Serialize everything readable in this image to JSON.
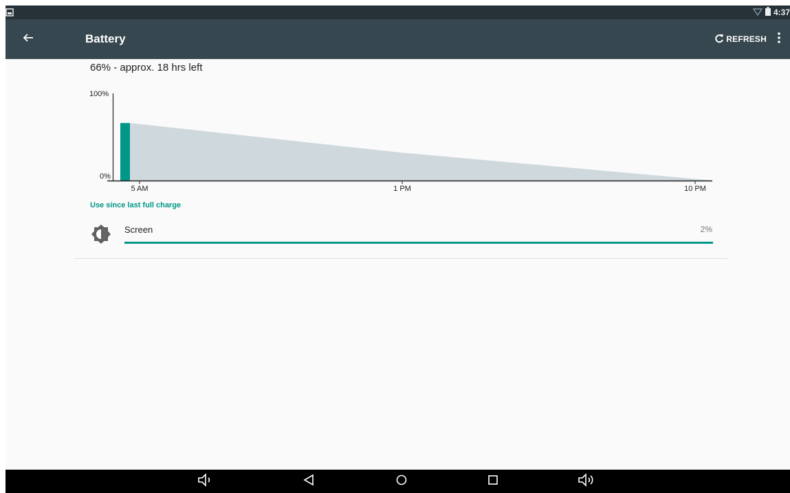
{
  "status_bar": {
    "time": "4:37"
  },
  "app_bar": {
    "title": "Battery",
    "refresh_label": "REFRESH"
  },
  "summary": {
    "text": "66% - approx. 18 hrs left"
  },
  "chart_data": {
    "type": "area",
    "y_tick_labels": [
      "100%",
      "0%"
    ],
    "x_tick_labels": [
      "5 AM",
      "1 PM",
      "10 PM"
    ],
    "x": [
      "5 AM",
      "1 PM",
      "10 PM"
    ],
    "series": [
      {
        "kind": "actual",
        "color": "#009688",
        "values": [
          66
        ]
      },
      {
        "kind": "projected",
        "color": "#cfd8dc",
        "values": [
          66,
          32,
          0
        ]
      }
    ],
    "ylim": [
      0,
      100
    ]
  },
  "usage": {
    "section_title": "Use since last full charge",
    "items": [
      {
        "label": "Screen",
        "percent": "2%",
        "bar_fraction": 1.0,
        "icon": "brightness-icon"
      }
    ]
  },
  "colors": {
    "accent": "#009688",
    "app_bar": "#37474f",
    "status_bar": "#263238",
    "nav_bar": "#000000"
  },
  "nav_bar": {
    "icons": [
      "volume-down-icon",
      "back-icon",
      "home-icon",
      "recents-icon",
      "volume-up-icon"
    ]
  }
}
